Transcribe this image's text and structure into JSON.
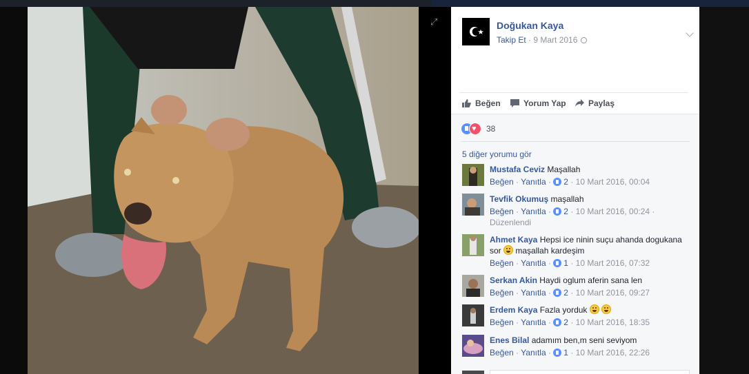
{
  "post": {
    "page_name": "Doğukan Kaya",
    "follow_label": "Takip Et",
    "meta_sep": " · ",
    "date": "9 Mart 2016",
    "avatar_icon": "crescent-star-icon"
  },
  "actions": {
    "like": "Beğen",
    "comment": "Yorum Yap",
    "share": "Paylaş"
  },
  "reactions": {
    "count": "38"
  },
  "more_comments": "5 diğer yorumu gör",
  "comment_ui": {
    "like": "Beğen",
    "reply": "Yanıtla",
    "dot": " · "
  },
  "comments": [
    {
      "name": "Mustafa Ceviz",
      "text": "Maşallah",
      "likes": "2",
      "time": "10 Mart 2016, 00:04",
      "edited": ""
    },
    {
      "name": "Tevfik Okumuş",
      "text": "maşallah",
      "likes": "2",
      "time": "10 Mart 2016, 00:24",
      "edited": "Düzenlendi"
    },
    {
      "name": "Ahmet Kaya",
      "text": "Hepsi ice ninin suçu ahanda dogukana sor",
      "text2": "maşallah kardeşim",
      "likes": "1",
      "time": "10 Mart 2016, 07:32",
      "edited": ""
    },
    {
      "name": "Serkan Akin",
      "text": "Haydi oglum aferin sana len",
      "likes": "2",
      "time": "10 Mart 2016, 09:27",
      "edited": ""
    },
    {
      "name": "Erdem Kaya",
      "text": "Fazla yorduk",
      "likes": "2",
      "time": "10 Mart 2016, 18:35",
      "edited": ""
    },
    {
      "name": "Enes Bilal",
      "text": "adamım ben,m seni seviyom",
      "likes": "1",
      "time": "10 Mart 2016, 22:26",
      "edited": ""
    }
  ],
  "colors": {
    "link": "#365899",
    "meta": "#90949c",
    "like_blue": "#5890ff",
    "love_red": "#f25268"
  }
}
